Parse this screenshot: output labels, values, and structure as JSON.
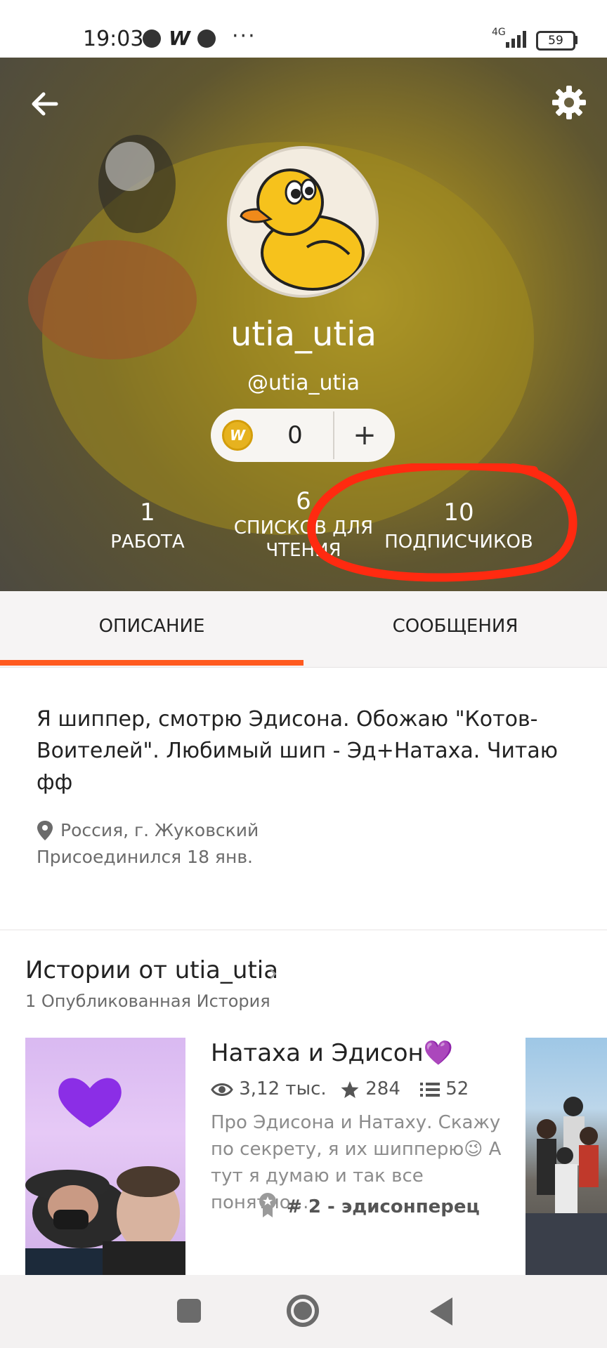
{
  "status_bar": {
    "time": "19:03",
    "app_w": "W",
    "more": "···",
    "network": "4G",
    "battery": "59"
  },
  "profile": {
    "display_name": "utia_utia",
    "handle": "@utia_utia",
    "coins": "0",
    "add_coins": "+",
    "stats": [
      {
        "number": "1",
        "label": "РАБОТА"
      },
      {
        "number": "6",
        "label_line1": "СПИСКОВ ДЛЯ",
        "label_line2": "ЧТЕНИЯ"
      },
      {
        "number": "10",
        "label": "ПОДПИСЧИКОВ"
      }
    ]
  },
  "tabs": {
    "about": "ОПИСАНИЕ",
    "messages": "СООБЩЕНИЯ"
  },
  "about": {
    "text": "Я шиппер, смотрю Эдисона. Обожаю \"Котов-Воителей\". Любимый шип - Эд+Натаха. Читаю фф",
    "location": "Россия, г. Жуковский",
    "joined": "Присоединился 18 янв."
  },
  "stories": {
    "title": "Истории от utia_utia",
    "count_label": "1 Опубликованная История",
    "items": [
      {
        "title": "Натаха и Эдисон💜",
        "reads": "3,12 тыс.",
        "votes": "284",
        "parts": "52",
        "description": "Про Эдисона и Натаху. Скажу по секрету, я их шипперю😉 А тут я думаю и так все понятно…",
        "tag": "# 2 - эдисонперец"
      }
    ]
  },
  "colors": {
    "accent": "#ff5a1f",
    "annotation": "#ff2a10"
  }
}
